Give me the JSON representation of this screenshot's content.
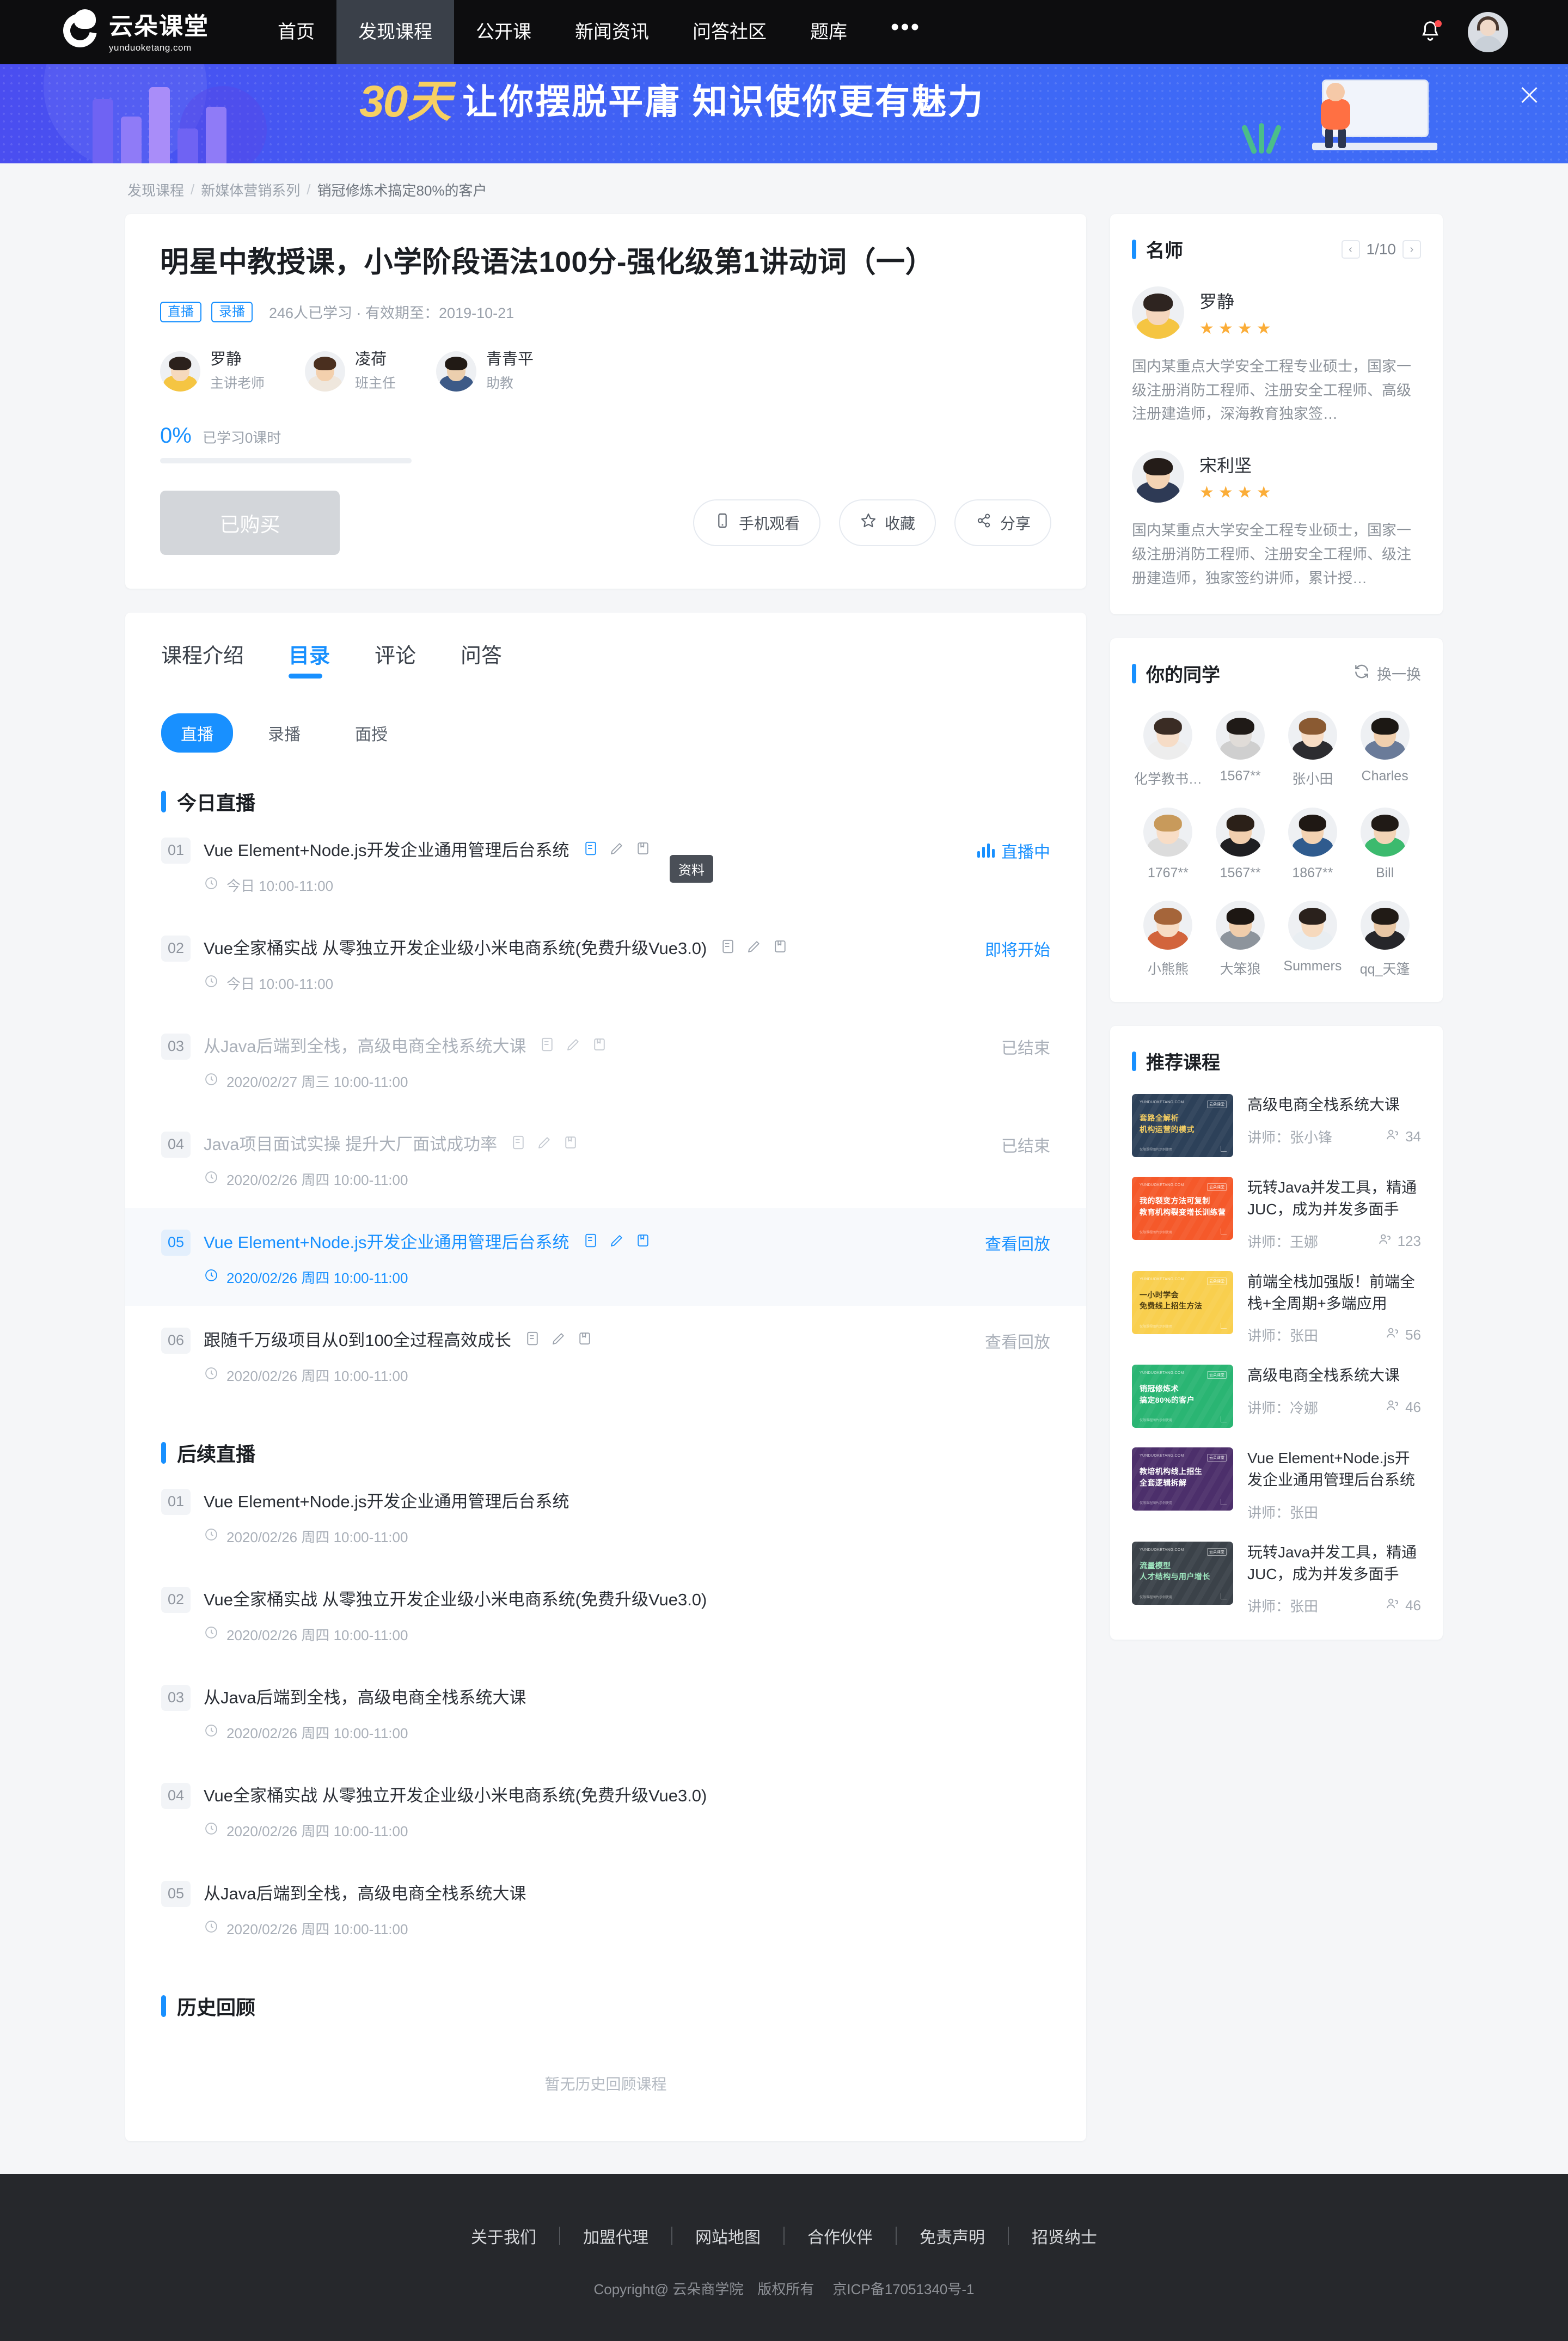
{
  "nav": {
    "logo_cn": "云朵课堂",
    "logo_en": "yunduoketang.com",
    "items": [
      {
        "label": "首页",
        "active": false
      },
      {
        "label": "发现课程",
        "active": true
      },
      {
        "label": "公开课",
        "active": false
      },
      {
        "label": "新闻资讯",
        "active": false
      },
      {
        "label": "问答社区",
        "active": false
      },
      {
        "label": "题库",
        "active": false
      },
      {
        "label": "•••",
        "active": false
      }
    ]
  },
  "banner": {
    "highlight": "30天",
    "text": "让你摆脱平庸 知识使你更有魅力",
    "highlight_color": "#f6cf62",
    "bg_color": "#3e64f5"
  },
  "breadcrumb": {
    "items": [
      "发现课程",
      "新媒体营销系列",
      "销冠修炼术搞定80%的客户"
    ],
    "separator": "/"
  },
  "course": {
    "title": "明星中教授课，小学阶段语法100分-强化级第1讲动词（一）",
    "tags": [
      "直播",
      "录播"
    ],
    "meta": "246人已学习 · 有效期至：2019-10-21",
    "teachers": [
      {
        "name": "罗静",
        "role": "主讲老师"
      },
      {
        "name": "凌荷",
        "role": "班主任"
      },
      {
        "name": "青青平",
        "role": "助教"
      }
    ],
    "progress_pct": "0%",
    "progress_label": "已学习0课时",
    "progress_value": 0,
    "buy_button": "已购买",
    "actions": [
      {
        "label": "手机观看",
        "icon": "mobile-icon"
      },
      {
        "label": "收藏",
        "icon": "star-icon"
      },
      {
        "label": "分享",
        "icon": "share-icon"
      }
    ]
  },
  "catalog": {
    "tabs": [
      {
        "label": "课程介绍",
        "active": false
      },
      {
        "label": "目录",
        "active": true
      },
      {
        "label": "评论",
        "active": false
      },
      {
        "label": "问答",
        "active": false
      }
    ],
    "pills": [
      {
        "label": "直播",
        "active": true
      },
      {
        "label": "录播",
        "active": false
      },
      {
        "label": "面授",
        "active": false
      }
    ],
    "tooltip": "资料",
    "sections": [
      {
        "title": "今日直播",
        "show_icons": true,
        "lessons": [
          {
            "num": "01",
            "title": "Vue Element+Node.js开发企业通用管理后台系统",
            "time": "今日 10:00-11:00",
            "status": "直播中",
            "status_type": "live",
            "state": "normal"
          },
          {
            "num": "02",
            "title": "Vue全家桶实战 从零独立开发企业级小米电商系统(免费升级Vue3.0)",
            "time": "今日 10:00-11:00",
            "status": "即将开始",
            "status_type": "soon",
            "state": "normal"
          },
          {
            "num": "03",
            "title": "从Java后端到全栈，高级电商全栈系统大课",
            "time": "2020/02/27 周三 10:00-11:00",
            "status": "已结束",
            "status_type": "ended",
            "state": "dim"
          },
          {
            "num": "04",
            "title": "Java项目面试实操 提升大厂面试成功率",
            "time": "2020/02/26 周四 10:00-11:00",
            "status": "已结束",
            "status_type": "ended",
            "state": "dim"
          },
          {
            "num": "05",
            "title": "Vue Element+Node.js开发企业通用管理后台系统",
            "time": "2020/02/26 周四 10:00-11:00",
            "status": "查看回放",
            "status_type": "replay",
            "state": "highlight"
          },
          {
            "num": "06",
            "title": "跟随千万级项目从0到100全过程高效成长",
            "time": "2020/02/26 周四 10:00-11:00",
            "status": "查看回放",
            "status_type": "replay-dim",
            "state": "normal"
          }
        ]
      },
      {
        "title": "后续直播",
        "show_icons": false,
        "lessons": [
          {
            "num": "01",
            "title": "Vue Element+Node.js开发企业通用管理后台系统",
            "time": "2020/02/26 周四 10:00-11:00",
            "status": "",
            "status_type": "none",
            "state": "normal"
          },
          {
            "num": "02",
            "title": "Vue全家桶实战 从零独立开发企业级小米电商系统(免费升级Vue3.0)",
            "time": "2020/02/26 周四 10:00-11:00",
            "status": "",
            "status_type": "none",
            "state": "normal"
          },
          {
            "num": "03",
            "title": "从Java后端到全栈，高级电商全栈系统大课",
            "time": "2020/02/26 周四 10:00-11:00",
            "status": "",
            "status_type": "none",
            "state": "normal"
          },
          {
            "num": "04",
            "title": "Vue全家桶实战 从零独立开发企业级小米电商系统(免费升级Vue3.0)",
            "time": "2020/02/26 周四 10:00-11:00",
            "status": "",
            "status_type": "none",
            "state": "normal"
          },
          {
            "num": "05",
            "title": "从Java后端到全栈，高级电商全栈系统大课",
            "time": "2020/02/26 周四 10:00-11:00",
            "status": "",
            "status_type": "none",
            "state": "normal"
          }
        ]
      }
    ],
    "history": {
      "title": "历史回顾",
      "empty_text": "暂无历史回顾课程"
    }
  },
  "sidebar": {
    "famous": {
      "title": "名师",
      "pager": "1/10",
      "teachers": [
        {
          "name": "罗静",
          "stars": 4,
          "desc": "国内某重点大学安全工程专业硕士，国家一级注册消防工程师、注册安全工程师、高级注册建造师，深海教育独家签…",
          "hair": "#2e2420",
          "skin": "#f5d6bd",
          "cloth": "#f5c542"
        },
        {
          "name": "宋利坚",
          "stars": 4,
          "desc": "国内某重点大学安全工程专业硕士，国家一级注册消防工程师、注册安全工程师、级注册建造师，独家签约讲师，累计授…",
          "hair": "#241c18",
          "skin": "#f3d3b4",
          "cloth": "#2e3a55"
        }
      ]
    },
    "classmates": {
      "title": "你的同学",
      "refresh_label": "换一换",
      "items": [
        {
          "name": "化学教书…",
          "hair": "#3a2c24",
          "skin": "#f6dcc6",
          "cloth": "#ededed"
        },
        {
          "name": "1567**",
          "hair": "#1f1a17",
          "skin": "#e0dcd8",
          "cloth": "#cfcfcf"
        },
        {
          "name": "张小田",
          "hair": "#8a5a32",
          "skin": "#f7dcc4",
          "cloth": "#2c2c30"
        },
        {
          "name": "Charles",
          "hair": "#1c1814",
          "skin": "#f0cfae",
          "cloth": "#6a7b99"
        },
        {
          "name": "1767**",
          "hair": "#c89a5b",
          "skin": "#f8ddc6",
          "cloth": "#dcdcdc"
        },
        {
          "name": "1567**",
          "hair": "#2b2018",
          "skin": "#f2cfae",
          "cloth": "#1f1f22"
        },
        {
          "name": "1867**",
          "hair": "#1f1814",
          "skin": "#f3d2b2",
          "cloth": "#2f5b8e"
        },
        {
          "name": "Bill",
          "hair": "#201a16",
          "skin": "#f3d4b6",
          "cloth": "#3cba6e"
        },
        {
          "name": "小熊熊",
          "hair": "#a5653a",
          "skin": "#f7dcc4",
          "cloth": "#d2643c"
        },
        {
          "name": "大笨狼",
          "hair": "#1d1713",
          "skin": "#f0cdab",
          "cloth": "#8d949c"
        },
        {
          "name": "Summers",
          "hair": "#2a211c",
          "skin": "#f6d9bd",
          "cloth": "#e9eef2"
        },
        {
          "name": "qq_天篷",
          "hair": "#211b16",
          "skin": "#e8c7a5",
          "cloth": "#26262a"
        }
      ]
    },
    "recommended": {
      "title": "推荐课程",
      "items": [
        {
          "title": "高级电商全栈系统大课",
          "teacher_label": "讲师：张小锋",
          "count": "34",
          "thumb_color": "#2d4159",
          "thumb_l1": "套路全解析",
          "thumb_l2": "机构运营的模式",
          "thumb_accent": "#f6cf62"
        },
        {
          "title": "玩转Java并发工具，精通JUC，成为并发多面手",
          "teacher_label": "讲师：王娜",
          "count": "123",
          "thumb_color": "#f5592a",
          "thumb_l1": "我的裂变方法可复制",
          "thumb_l2": "教育机构裂变增长训练营",
          "thumb_accent": "#ffffff"
        },
        {
          "title": "前端全栈加强版！前端全栈+全周期+多端应用",
          "teacher_label": "讲师：张田",
          "count": "56",
          "thumb_color": "#f9cf4e",
          "thumb_l1": "一小时学会",
          "thumb_l2": "免费线上招生方法",
          "thumb_accent": "#4a3a10"
        },
        {
          "title": "高级电商全栈系统大课",
          "teacher_label": "讲师：冷娜",
          "count": "46",
          "thumb_color": "#2ab573",
          "thumb_l1": "销冠修炼术",
          "thumb_l2": "搞定80%的客户",
          "thumb_accent": "#ffffff"
        },
        {
          "title": "Vue Element+Node.js开发企业通用管理后台系统",
          "teacher_label": "讲师：张田",
          "count": "",
          "thumb_color": "#4c2f6b",
          "thumb_l1": "教培机构线上招生",
          "thumb_l2": "全套逻辑拆解",
          "thumb_accent": "#ffffff"
        },
        {
          "title": "玩转Java并发工具，精通JUC，成为并发多面手",
          "teacher_label": "讲师：张田",
          "count": "46",
          "thumb_color": "#3b4249",
          "thumb_l1": "流量模型",
          "thumb_l2": "人才结构与用户增长",
          "thumb_accent": "#9fe8c0"
        }
      ]
    }
  },
  "footer": {
    "links": [
      "关于我们",
      "加盟代理",
      "网站地图",
      "合作伙伴",
      "免责声明",
      "招贤纳士"
    ],
    "copyright": "Copyright@ 云朵商学院　版权所有",
    "icp": "京ICP备17051340号-1"
  }
}
